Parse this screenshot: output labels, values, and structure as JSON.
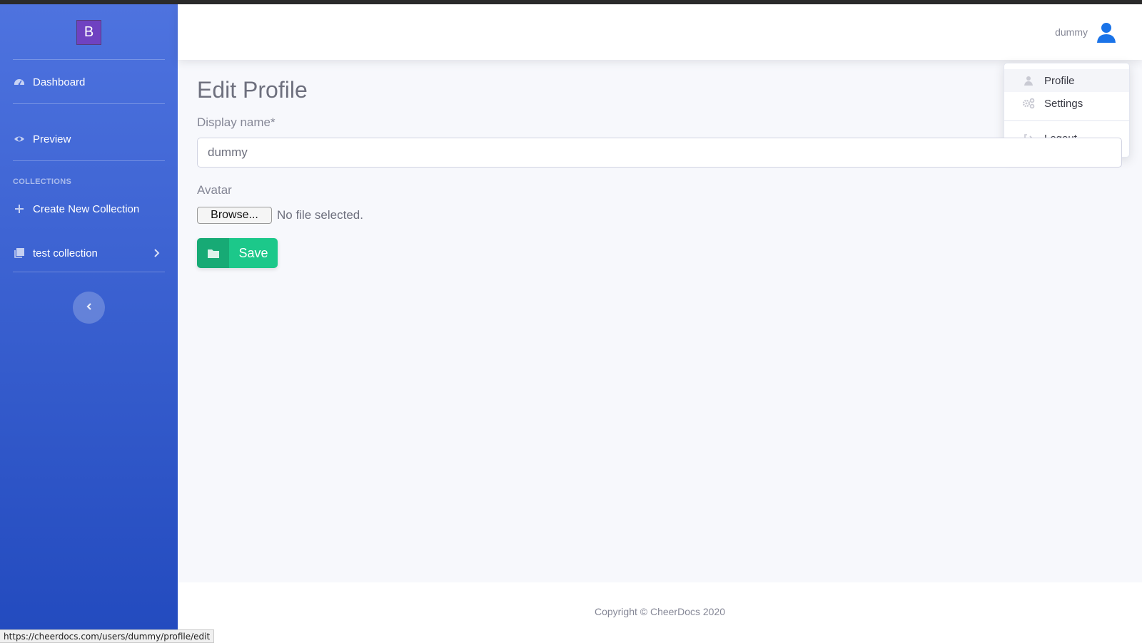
{
  "sidebar": {
    "brand_letter": "B",
    "items": [
      {
        "label": "Dashboard",
        "icon": "dashboard-icon"
      },
      {
        "label": "Preview",
        "icon": "eye-icon"
      }
    ],
    "collections_heading": "COLLECTIONS",
    "create_collection_label": "Create New Collection",
    "collections": [
      {
        "label": "test collection",
        "icon": "collection-icon"
      }
    ],
    "toggle_icon": "chevron-left-icon"
  },
  "topbar": {
    "username": "dummy",
    "avatar_icon": "user-icon",
    "avatar_color": "#1a73e8"
  },
  "user_menu": {
    "items": [
      {
        "label": "Profile",
        "icon": "user-icon",
        "active": true
      },
      {
        "label": "Settings",
        "icon": "cogs-icon"
      },
      {
        "label": "Logout",
        "icon": "sign-out-icon"
      }
    ]
  },
  "main": {
    "title": "Edit Profile",
    "display_name_label": "Display name*",
    "display_name_value": "dummy",
    "avatar_label": "Avatar",
    "browse_label": "Browse...",
    "file_status": "No file selected.",
    "save_label": "Save",
    "save_icon": "folder-icon"
  },
  "footer": {
    "copyright": "Copyright © CheerDocs 2020"
  },
  "status_url": "https://cheerdocs.com/users/dummy/profile/edit",
  "colors": {
    "sidebar_top": "#4e73df",
    "sidebar_bottom": "#224abe",
    "success": "#1cc88a"
  }
}
